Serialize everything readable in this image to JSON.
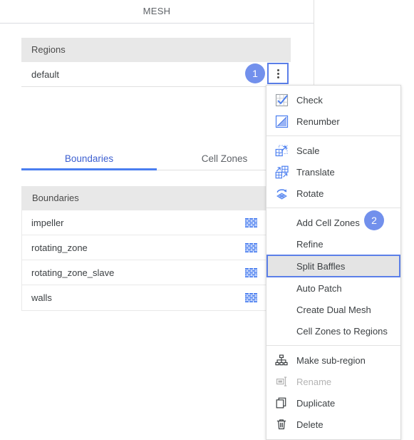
{
  "panel": {
    "title": "MESH"
  },
  "regions": {
    "header": "Regions",
    "rows": [
      {
        "name": "default"
      }
    ],
    "kebab_icon": "more-vertical-icon"
  },
  "callouts": [
    {
      "id": "badge-1",
      "label": "1"
    },
    {
      "id": "badge-2",
      "label": "2"
    }
  ],
  "tabs": [
    {
      "label": "Boundaries",
      "active": true
    },
    {
      "label": "Cell Zones",
      "active": false
    }
  ],
  "boundaries": {
    "header": "Boundaries",
    "rows": [
      {
        "name": "impeller",
        "icon": "wall-brick-icon",
        "expand_icon": "chevron-down-icon"
      },
      {
        "name": "rotating_zone",
        "icon": "wall-brick-icon",
        "expand_icon": "chevron-down-icon"
      },
      {
        "name": "rotating_zone_slave",
        "icon": "wall-brick-icon",
        "expand_icon": "chevron-down-icon"
      },
      {
        "name": "walls",
        "icon": "wall-brick-icon",
        "expand_icon": "chevron-down-icon"
      }
    ]
  },
  "context_menu": {
    "items": [
      {
        "label": "Check",
        "icon": "mesh-check-icon",
        "type": "item"
      },
      {
        "label": "Renumber",
        "icon": "mesh-renumber-icon",
        "type": "item"
      },
      {
        "type": "separator"
      },
      {
        "label": "Scale",
        "icon": "mesh-scale-icon",
        "type": "item"
      },
      {
        "label": "Translate",
        "icon": "mesh-translate-icon",
        "type": "item"
      },
      {
        "label": "Rotate",
        "icon": "mesh-rotate-icon",
        "type": "item"
      },
      {
        "type": "separator"
      },
      {
        "label": "Add Cell Zones",
        "icon": null,
        "type": "item"
      },
      {
        "label": "Refine",
        "icon": null,
        "type": "item"
      },
      {
        "label": "Split Baffles",
        "icon": null,
        "type": "item",
        "highlighted": true
      },
      {
        "label": "Auto Patch",
        "icon": null,
        "type": "item"
      },
      {
        "label": "Create Dual Mesh",
        "icon": null,
        "type": "item"
      },
      {
        "label": "Cell Zones to Regions",
        "icon": null,
        "type": "item"
      },
      {
        "type": "separator"
      },
      {
        "label": "Make sub-region",
        "icon": "hierarchy-icon",
        "type": "item"
      },
      {
        "label": "Rename",
        "icon": "rename-icon",
        "type": "item",
        "disabled": true
      },
      {
        "label": "Duplicate",
        "icon": "duplicate-icon",
        "type": "item"
      },
      {
        "label": "Delete",
        "icon": "trash-icon",
        "type": "item"
      }
    ]
  },
  "colors": {
    "accent_blue": "#4a7ef0",
    "badge_blue": "#7290ec",
    "focus_blue": "#5b7fe8",
    "header_gray": "#e8e8e8",
    "highlight_gray": "#e4e4e4",
    "text": "#3c4043",
    "muted_text": "#5f6368",
    "disabled_text": "#b4b4b4"
  }
}
